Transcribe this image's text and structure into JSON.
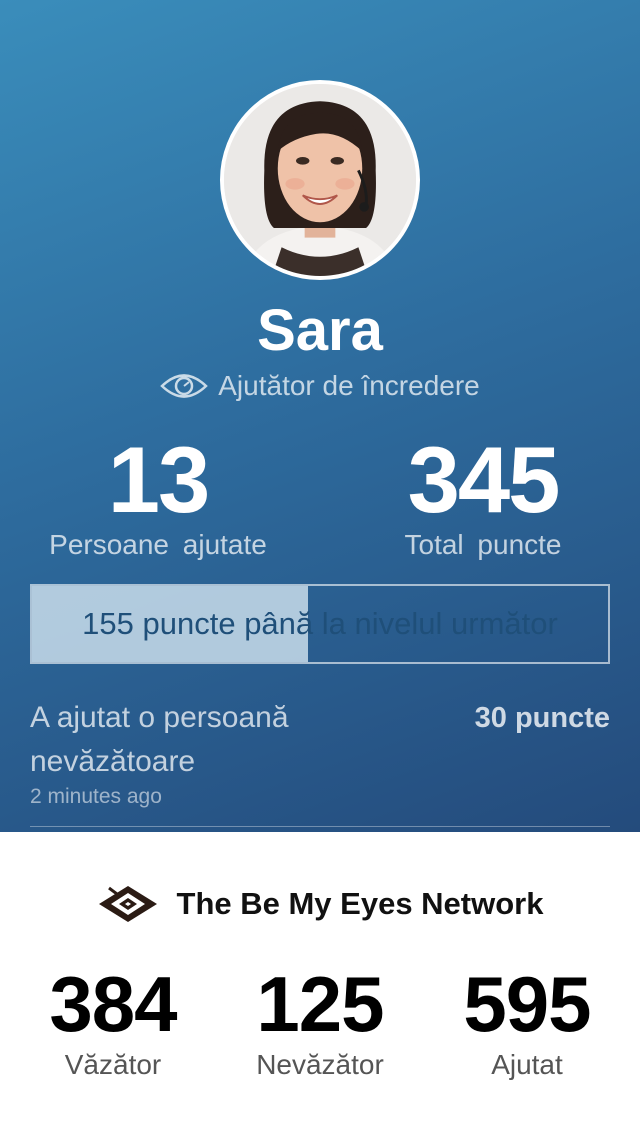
{
  "profile": {
    "name": "Sara",
    "role": "Ajutător de încredere",
    "stats": {
      "helped_value": "13",
      "helped_label": "Persoane ajutate",
      "points_value": "345",
      "points_label": "Total puncte"
    },
    "progress": {
      "text": "155 puncte până la nivelul următor",
      "fraction": 0.48
    },
    "activity": {
      "text": "A ajutat o persoană nevăzătoare",
      "time": "2 minutes ago",
      "points": "30 puncte"
    }
  },
  "network": {
    "title": "The Be My Eyes Network",
    "stats": [
      {
        "value": "384",
        "label": "Văzător"
      },
      {
        "value": "125",
        "label": "Nevăzător"
      },
      {
        "value": "595",
        "label": "Ajutat"
      }
    ]
  },
  "icons": {
    "role_icon": "eye-icon",
    "network_logo": "be-my-eyes-logo-icon"
  },
  "colors": {
    "gradient_start": "#3a8dbb",
    "gradient_end": "#244b7c",
    "progress_fill": "#d0e2ee",
    "progress_text": "#1f4f79"
  }
}
